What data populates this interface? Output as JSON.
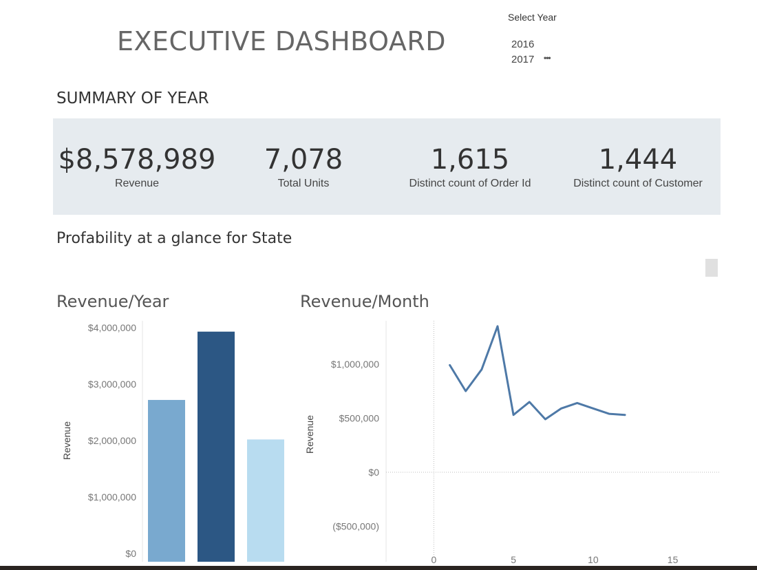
{
  "header": {
    "title": "EXECUTIVE DASHBOARD"
  },
  "year_filter": {
    "label": "Select Year",
    "options": [
      "2016",
      "2017"
    ],
    "more_icon": "ellipsis-icon"
  },
  "summary": {
    "title": "SUMMARY OF YEAR",
    "kpis": [
      {
        "value": "$8,578,989",
        "label": "Revenue"
      },
      {
        "value": "7,078",
        "label": "Total Units"
      },
      {
        "value": "1,615",
        "label": "Distinct count of Order Id"
      },
      {
        "value": "1,444",
        "label": "Distinct count of Customer"
      }
    ]
  },
  "profitability": {
    "title": "Profability at a glance for State"
  },
  "colors": {
    "panel_bg": "#e6ebef",
    "bar_1": "#79a9cf",
    "bar_2": "#2c5784",
    "bar_3": "#b8dcf0",
    "line": "#4e79a7"
  },
  "chart_data": [
    {
      "type": "bar",
      "title": "Revenue/Year",
      "ylabel": "Revenue",
      "yticks": [
        "$0",
        "$1,000,000",
        "$2,000,000",
        "$3,000,000",
        "$4,000,000"
      ],
      "ylim": [
        0,
        4000000
      ],
      "values": [
        2720000,
        3930000,
        2020000
      ]
    },
    {
      "type": "line",
      "title": "Revenue/Month",
      "ylabel": "Revenue",
      "yticks": [
        "($500,000)",
        "$0",
        "$500,000",
        "$1,000,000"
      ],
      "xticks": [
        "0",
        "5",
        "10",
        "15"
      ],
      "xlim": [
        -3,
        18
      ],
      "ylim": [
        -700000,
        1400000
      ],
      "x": [
        1,
        2,
        3,
        4,
        5,
        6,
        7,
        8,
        9,
        10,
        11,
        12
      ],
      "y": [
        990000,
        750000,
        950000,
        1350000,
        530000,
        650000,
        490000,
        590000,
        640000,
        590000,
        540000,
        530000
      ]
    }
  ]
}
